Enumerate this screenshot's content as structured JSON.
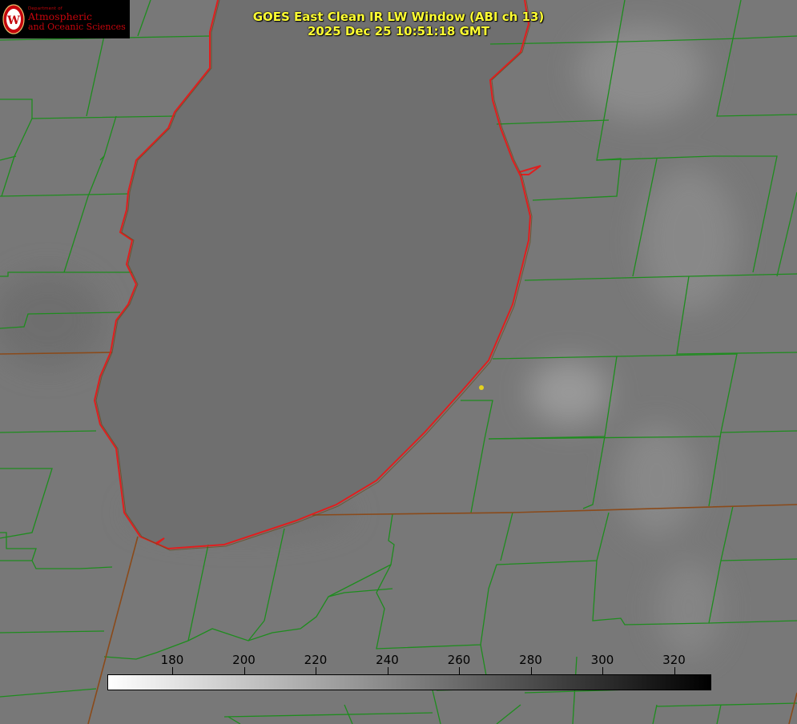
{
  "title": {
    "line1": "GOES East Clean IR LW Window (ABI ch 13)",
    "line2": "2025 Dec 25 10:51:18 GMT"
  },
  "logo": {
    "dept": "Department of",
    "line1": "Atmospheric",
    "line2": "and Oceanic Sciences",
    "seal_letter": "W",
    "color": "#c5050c"
  },
  "colorbar": {
    "ticks": [
      "180",
      "200",
      "220",
      "240",
      "260",
      "280",
      "300",
      "320"
    ],
    "gradient_from": "#ffffff",
    "gradient_to": "#000000"
  },
  "colors": {
    "county_lines": "#1e8c1e",
    "coastline": "#e01e1e",
    "state_lines": "#8a4a1a",
    "station_marker": "#e4d21e"
  }
}
